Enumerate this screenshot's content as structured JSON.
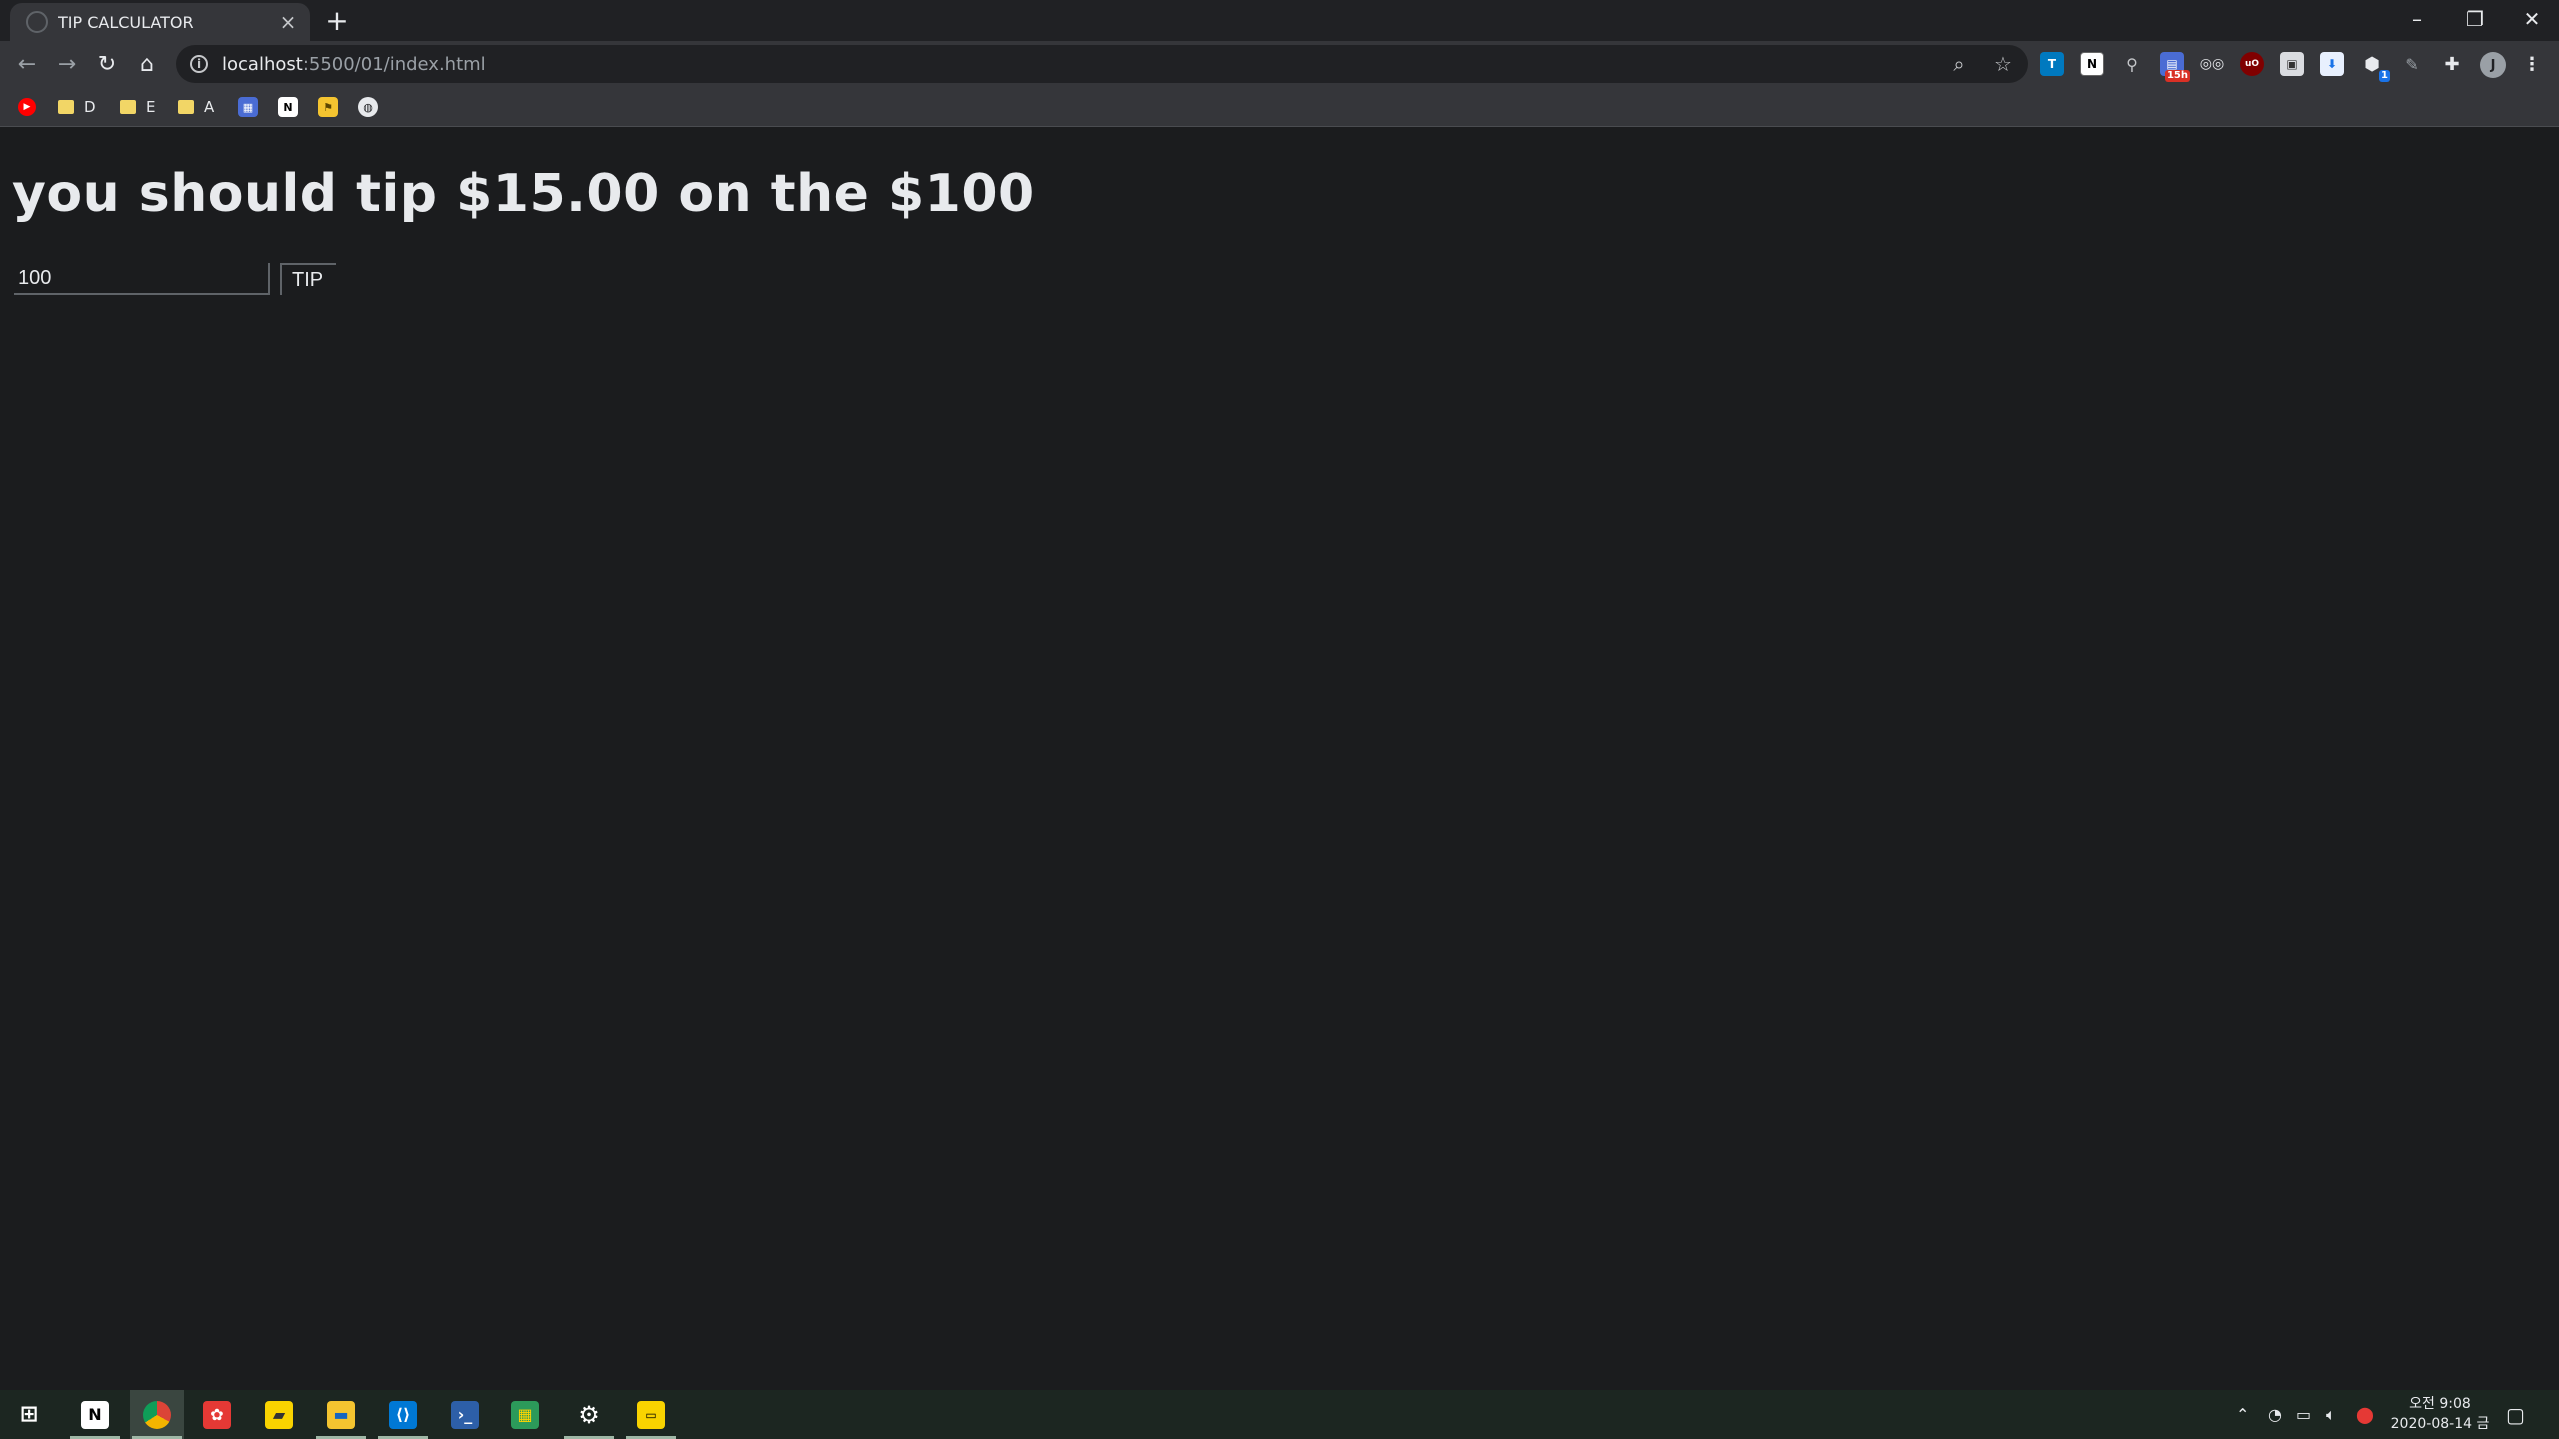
{
  "browser": {
    "tab_title": "TIP CALCULATOR",
    "new_tab_label": "+",
    "url_host": "localhost",
    "url_rest": ":5500/01/index.html",
    "profile_initial": "J",
    "extension_badge": "15h",
    "extension_badge_2": "1"
  },
  "bookmarks": [
    {
      "label": "D"
    },
    {
      "label": "E"
    },
    {
      "label": "A"
    }
  ],
  "page": {
    "heading": "you should tip $15.00 on the $100",
    "amount_value": "100",
    "tip_button_label": "TIP"
  },
  "taskbar": {
    "clock_time": "오전 9:08",
    "clock_date": "2020-08-14 금"
  },
  "colors": {
    "page_background": "#1b1c1e",
    "heading_text": "#e8eaed",
    "taskbar_background": "#1c2621"
  }
}
